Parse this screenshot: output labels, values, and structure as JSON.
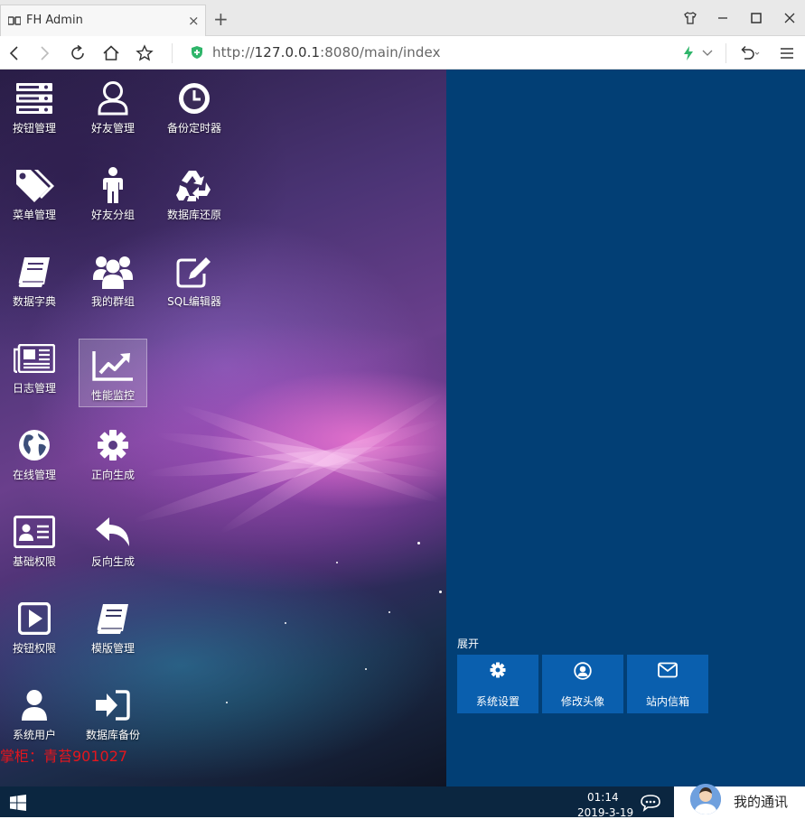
{
  "browser": {
    "tab_title": "FH Admin",
    "tab_close": "×",
    "new_tab": "+",
    "url_scheme": "http://",
    "url_host": "127.0.0.1",
    "url_rest": ":8080/main/index"
  },
  "desktop_icons": [
    {
      "label": "按钮管理",
      "icon": "server-icon"
    },
    {
      "label": "好友管理",
      "icon": "user-outline-icon"
    },
    {
      "label": "备份定时器",
      "icon": "clock-icon"
    },
    {
      "label": "菜单管理",
      "icon": "tags-icon"
    },
    {
      "label": "好友分组",
      "icon": "male-icon"
    },
    {
      "label": "数据库还原",
      "icon": "recycle-icon"
    },
    {
      "label": "数据字典",
      "icon": "book-icon"
    },
    {
      "label": "我的群组",
      "icon": "users-icon"
    },
    {
      "label": "SQL编辑器",
      "icon": "edit-icon"
    },
    {
      "label": "日志管理",
      "icon": "newspaper-icon"
    },
    {
      "label": "性能监控",
      "icon": "line-chart-icon"
    },
    {
      "label": "在线管理",
      "icon": "globe-icon"
    },
    {
      "label": "正向生成",
      "icon": "gear-icon"
    },
    {
      "label": "基础权限",
      "icon": "id-card-icon"
    },
    {
      "label": "反向生成",
      "icon": "reply-icon"
    },
    {
      "label": "按钮权限",
      "icon": "play-square-icon"
    },
    {
      "label": "模版管理",
      "icon": "book-icon"
    },
    {
      "label": "系统用户",
      "icon": "user-icon"
    },
    {
      "label": "数据库备份",
      "icon": "sign-in-icon"
    }
  ],
  "watermark": "掌柜：青苔901027",
  "start_panel": {
    "expand_label": "展开",
    "tiles": [
      {
        "label": "系统设置",
        "icon": "gear-icon"
      },
      {
        "label": "修改头像",
        "icon": "user-circle-icon"
      },
      {
        "label": "站内信箱",
        "icon": "envelope-icon"
      }
    ]
  },
  "taskbar": {
    "time": "01:14",
    "date": "2019-3-19",
    "tray_label": "我的通讯"
  },
  "colors": {
    "desktop_bg": "#023f75",
    "tile_bg": "#0a5fae",
    "taskbar_bg": "#0b2640",
    "watermark": "#e5161d"
  }
}
